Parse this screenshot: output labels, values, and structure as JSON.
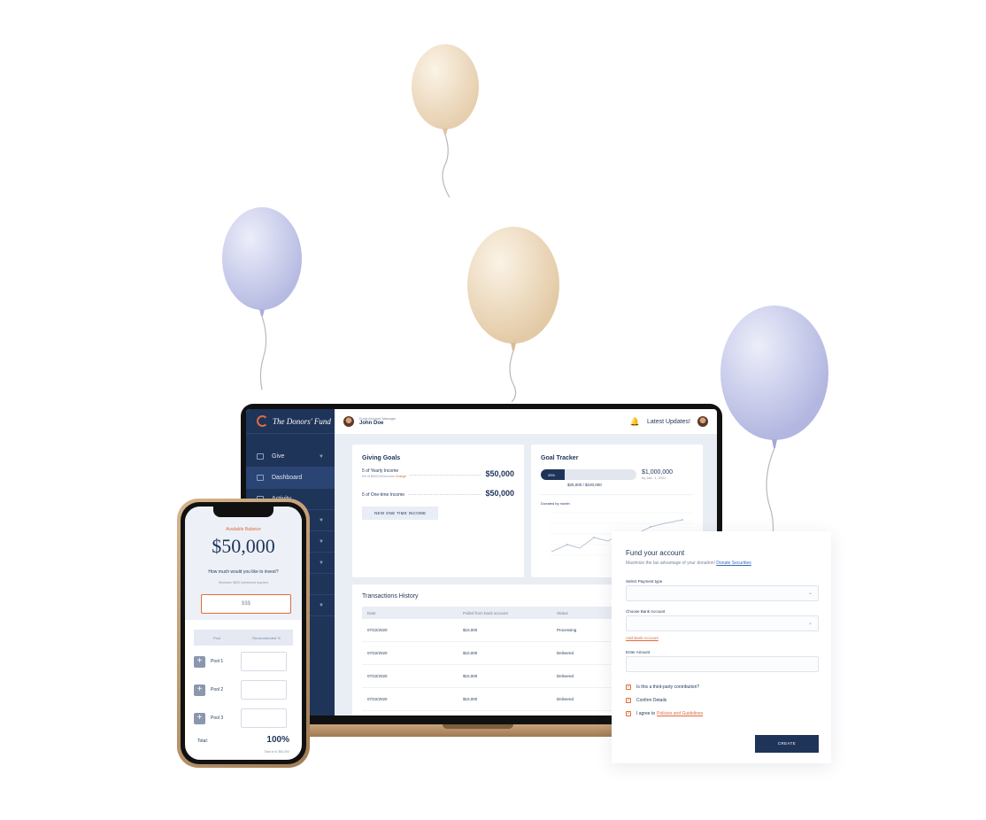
{
  "colors": {
    "navy": "#1f3459",
    "accent": "#e06b3b",
    "balloon_cream": "#f1dfc6",
    "balloon_lavender": "#c8cbea"
  },
  "dashboard": {
    "brand": "The Donors' Fund",
    "sidebar": {
      "items": [
        {
          "label": "Give",
          "icon": "give-icon",
          "active": false,
          "has_chevron": true
        },
        {
          "label": "Dashboard",
          "icon": "home-icon",
          "active": true,
          "has_chevron": false
        },
        {
          "label": "Activity",
          "icon": "activity-icon",
          "active": false,
          "has_chevron": false
        }
      ]
    },
    "topbar": {
      "user_role": "Fund Account Manager",
      "user_name": "John Doe",
      "latest_updates": "Latest Updates!"
    },
    "giving_goals": {
      "title": "Giving Goals",
      "rows": [
        {
          "label": "5 of Yearly Income",
          "sub": "5% of $500,000 income",
          "change": "Change",
          "amount": "$50,000"
        },
        {
          "label": "5 of One-time Income",
          "sub": "",
          "change": "",
          "amount": "$50,000"
        }
      ],
      "button": "NEW ONE TIME INCOME"
    },
    "goal_tracker": {
      "title": "Goal Tracker",
      "progress_label": "25%",
      "progress_fraction": 0.25,
      "total": "$1,000,000",
      "date": "by Jan. 1, 2021",
      "progress_text": "$25,000 / $100,000",
      "chart_title": "Donated by month"
    },
    "transactions": {
      "title": "Transactions History",
      "columns": [
        "Date",
        "Pulled from bank account",
        "Status"
      ],
      "rows": [
        {
          "date": "07/22/2020",
          "amount": "$10,000",
          "status": "Processing"
        },
        {
          "date": "07/22/2020",
          "amount": "$10,000",
          "status": "Delivered"
        },
        {
          "date": "07/22/2020",
          "amount": "$10,000",
          "status": "Delivered"
        },
        {
          "date": "07/22/2020",
          "amount": "$10,000",
          "status": "Delivered"
        }
      ]
    }
  },
  "phone": {
    "available_label": "Available Balance",
    "balance": "$50,000",
    "question": "How much would you like to invest?",
    "minimum": "Minimum: $500 investment required",
    "amount_placeholder": "$$$",
    "pool_columns": [
      "Pool",
      "Recommended %"
    ],
    "pools": [
      {
        "name": "Pool 1"
      },
      {
        "name": "Pool 2"
      },
      {
        "name": "Pool 3"
      }
    ],
    "total_label": "Total:",
    "total_percent": "100%",
    "total_in": "Total in $: $50,000"
  },
  "fund": {
    "title": "Fund your account",
    "subtitle": "Maximize the tax advantage of your donation!",
    "subtitle_link": "Donate Securities",
    "payment_label": "Select Payment type",
    "bank_label": "Choose Bank Account",
    "add_bank": "Add Bank Account",
    "amount_label": "Enter Amount",
    "check1": "Is this a third-party contribution?",
    "check2": "Confirm Details",
    "check3_prefix": "I agree to",
    "check3_link": "Policies and Guidelines",
    "create": "CREATE"
  }
}
